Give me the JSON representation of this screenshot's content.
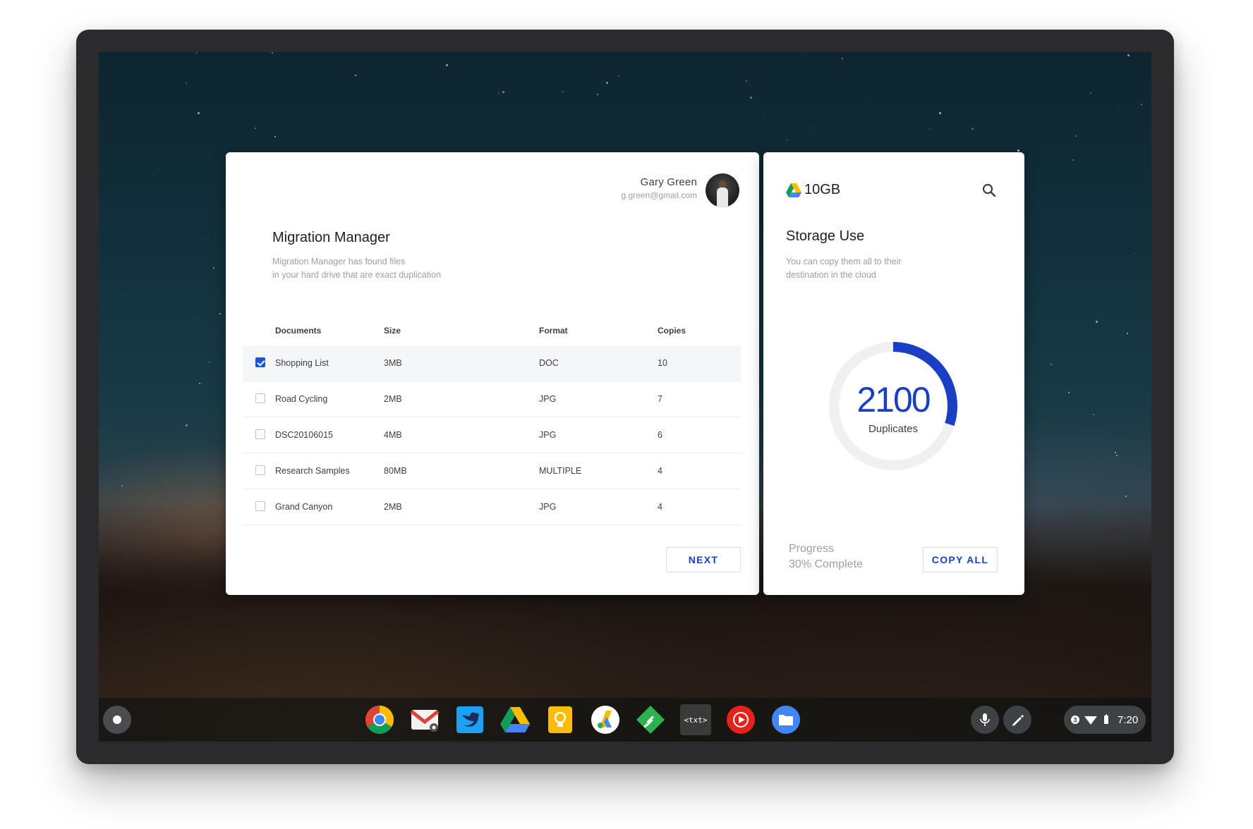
{
  "user": {
    "name": "Gary Green",
    "email": "g.green@gmail.com"
  },
  "migration": {
    "title": "Migration Manager",
    "subtitle_line1": "Migration Manager has found files",
    "subtitle_line2": "in your hard drive that are exact duplication",
    "columns": [
      "Documents",
      "Size",
      "Format",
      "Copies"
    ],
    "rows": [
      {
        "name": "Shopping List",
        "size": "3MB",
        "format": "DOC",
        "copies": "10",
        "checked": true
      },
      {
        "name": "Road Cycling",
        "size": "2MB",
        "format": "JPG",
        "copies": "7",
        "checked": false
      },
      {
        "name": "DSC20106015",
        "size": "4MB",
        "format": "JPG",
        "copies": "6",
        "checked": false
      },
      {
        "name": "Research Samples",
        "size": "80MB",
        "format": "MULTIPLE",
        "copies": "4",
        "checked": false
      },
      {
        "name": "Grand Canyon",
        "size": "2MB",
        "format": "JPG",
        "copies": "4",
        "checked": false
      }
    ],
    "next_label": "NEXT"
  },
  "storage": {
    "amount": "10GB",
    "title": "Storage Use",
    "subtitle_line1": "You can copy them all to their",
    "subtitle_line2": "destination in the cloud",
    "duplicates": "2100",
    "duplicates_label": "Duplicates",
    "progress_label": "Progress",
    "progress_value": "30% Complete",
    "progress_fraction": 0.3,
    "copy_all_label": "COPY ALL",
    "accent": "#1a3fc4"
  },
  "shelf": {
    "apps": [
      "chrome-icon",
      "gmail-icon",
      "twitter-icon",
      "drive-icon",
      "keep-icon",
      "adwords-icon",
      "feedly-icon",
      "text-editor-icon",
      "youtube-icon",
      "files-icon"
    ],
    "text_app_label": "<txt>",
    "clock": "7:20",
    "notification_count": "3"
  }
}
